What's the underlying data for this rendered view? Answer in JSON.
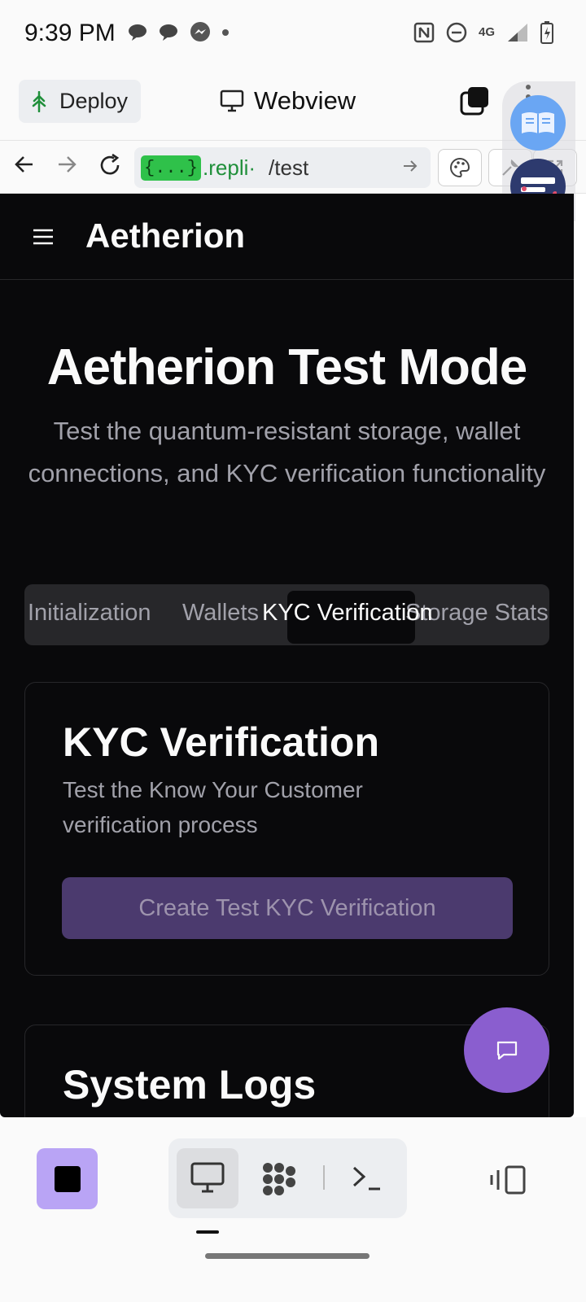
{
  "status_bar": {
    "time": "9:39 PM",
    "icons": [
      "chat-bubble-icon",
      "chat-bubble-icon",
      "messenger-icon",
      "dot-icon",
      "nfc-icon",
      "do-not-disturb-icon",
      "4g-lte-icon",
      "signal-icon",
      "battery-icon"
    ],
    "network": "4G"
  },
  "top_bar": {
    "deploy_label": "Deploy",
    "webview_label": "Webview"
  },
  "url_bar": {
    "badge": "{...}",
    "host": ".repli·",
    "path": "/test"
  },
  "app": {
    "brand": "Aetherion",
    "hero_title": "Aetherion Test Mode",
    "hero_subtitle": "Test the quantum-resistant storage, wallet connections, and KYC verification functionality",
    "tabs": [
      {
        "label": "Initialization",
        "active": false
      },
      {
        "label": "Wallets",
        "active": false
      },
      {
        "label": "KYC Verification",
        "active": true
      },
      {
        "label": "Storage Stats",
        "active": false
      }
    ],
    "kyc_card": {
      "title": "KYC Verification",
      "description": "Test the Know Your Customer verification process",
      "button_label": "Create Test KYC Verification"
    },
    "logs_card": {
      "title": "System Logs"
    }
  },
  "colors": {
    "app_background": "#09090b",
    "accent_purple": "#8a5ecf",
    "button_purple_disabled": "#4b3a6e",
    "repl_green": "#2fc14a"
  }
}
